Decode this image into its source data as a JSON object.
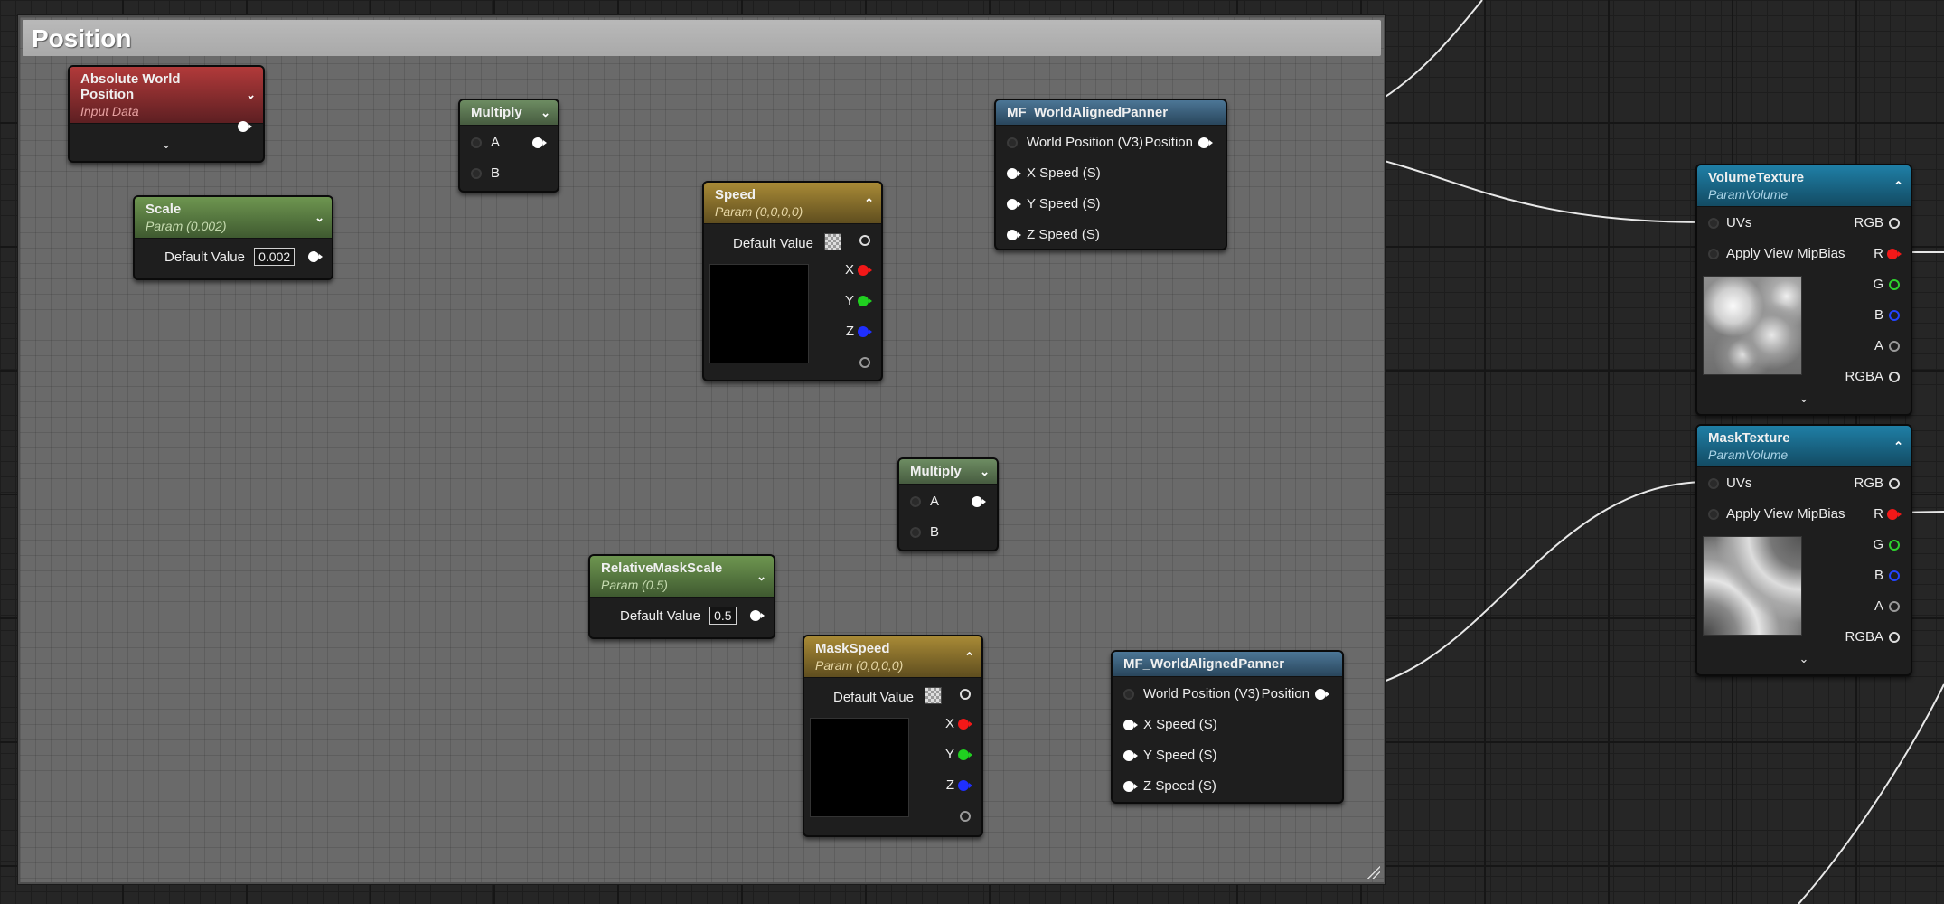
{
  "comment": {
    "title": "Position"
  },
  "nodes": {
    "abs_world_pos": {
      "title": "Absolute World Position",
      "subtitle": "Input Data"
    },
    "scale": {
      "title": "Scale",
      "subtitle": "Param (0.002)",
      "default_label": "Default Value",
      "default_value": "0.002"
    },
    "multiply1": {
      "title": "Multiply",
      "pin_a": "A",
      "pin_b": "B"
    },
    "speed": {
      "title": "Speed",
      "subtitle": "Param (0,0,0,0)",
      "default_label": "Default Value",
      "x": "X",
      "y": "Y",
      "z": "Z"
    },
    "panner1": {
      "title": "MF_WorldAlignedPanner",
      "world_pos": "World Position (V3)",
      "position": "Position",
      "xs": "X Speed (S)",
      "ys": "Y Speed (S)",
      "zs": "Z Speed (S)"
    },
    "multiply2": {
      "title": "Multiply",
      "pin_a": "A",
      "pin_b": "B"
    },
    "relmask": {
      "title": "RelativeMaskScale",
      "subtitle": "Param (0.5)",
      "default_label": "Default Value",
      "default_value": "0.5"
    },
    "maskspeed": {
      "title": "MaskSpeed",
      "subtitle": "Param (0,0,0,0)",
      "default_label": "Default Value",
      "x": "X",
      "y": "Y",
      "z": "Z"
    },
    "panner2": {
      "title": "MF_WorldAlignedPanner",
      "world_pos": "World Position (V3)",
      "position": "Position",
      "xs": "X Speed (S)",
      "ys": "Y Speed (S)",
      "zs": "Z Speed (S)"
    },
    "volumetex": {
      "title": "VolumeTexture",
      "subtitle": "ParamVolume",
      "uvs": "UVs",
      "mip": "Apply View MipBias",
      "rgb": "RGB",
      "r": "R",
      "g": "G",
      "b": "B",
      "a": "A",
      "rgba": "RGBA"
    },
    "masktex": {
      "title": "MaskTexture",
      "subtitle": "ParamVolume",
      "uvs": "UVs",
      "mip": "Apply View MipBias",
      "rgb": "RGB",
      "r": "R",
      "g": "G",
      "b": "B",
      "a": "A",
      "rgba": "RGBA"
    }
  },
  "icons": {
    "collapse": "chevron-down-icon",
    "expand": "chevron-up-icon",
    "resize": "resize-grip-icon"
  },
  "colors": {
    "pin_red": "#f21818",
    "pin_green": "#20d020",
    "pin_blue": "#1f2fff"
  }
}
